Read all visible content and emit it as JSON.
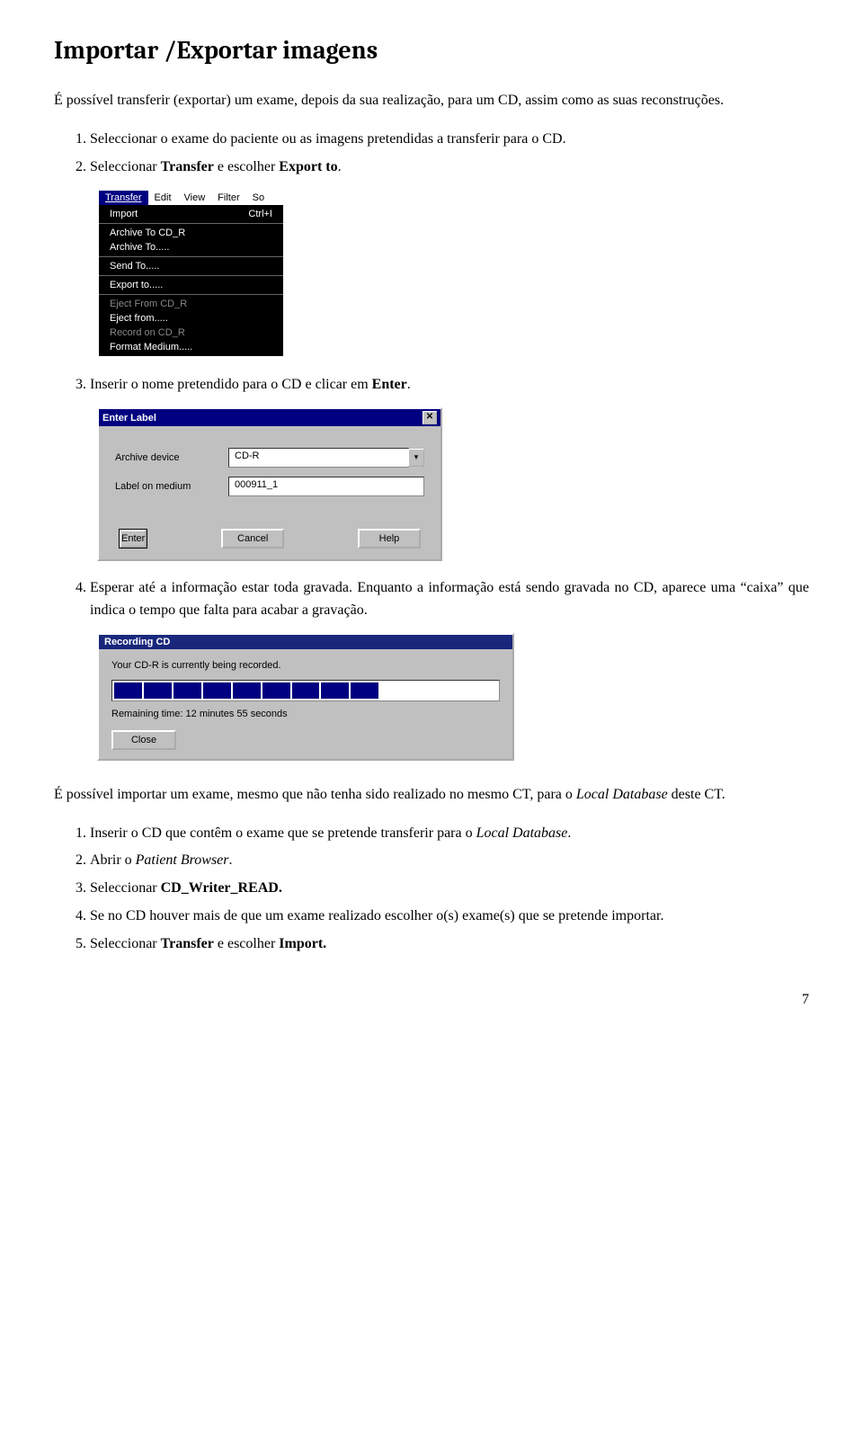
{
  "page": {
    "title": "Importar /Exportar imagens",
    "intro": "É possível transferir (exportar) um exame, depois da sua realização, para um CD, assim como as suas reconstruções.",
    "steps_a": {
      "1": "Seleccionar o exame do paciente ou as imagens pretendidas a transferir para o CD.",
      "2_pre": "Seleccionar ",
      "2_bold": "Transfer",
      "2_mid": " e escolher ",
      "2_bold2": "Export to",
      "2_post": ".",
      "3_pre": "Inserir o nome pretendido para o CD e clicar em ",
      "3_bold": "Enter",
      "3_post": ".",
      "4": "Esperar até a informação estar toda gravada. Enquanto a informação está sendo gravada no CD, aparece uma “caixa” que indica o tempo que falta para acabar a gravação."
    },
    "mid_para_pre": "É possível importar um exame, mesmo que não tenha sido realizado no mesmo CT, para o ",
    "mid_para_italic": "Local Database",
    "mid_para_post": " deste CT.",
    "steps_b": {
      "1_pre": "Inserir o CD que contêm o exame que se pretende transferir para o ",
      "1_italic": "Local Database",
      "1_post": ".",
      "2_pre": "Abrir o ",
      "2_italic": "Patient Browser",
      "2_post": ".",
      "3_pre": "Seleccionar ",
      "3_bold": "CD_Writer_READ.",
      "4": "Se no CD houver mais de que um exame realizado escolher o(s) exame(s) que se pretende importar.",
      "5_pre": "Seleccionar ",
      "5_bold": "Transfer",
      "5_mid": " e escolher ",
      "5_bold2": "Import."
    },
    "pagenum": "7"
  },
  "menu": {
    "tabs": [
      "Transfer",
      "Edit",
      "View",
      "Filter",
      "So"
    ],
    "items": {
      "import": "Import",
      "import_sc": "Ctrl+I",
      "archive_cdr": "Archive To CD_R",
      "archive_to": "Archive To.....",
      "send_to": "Send To.....",
      "export_to": "Export to.....",
      "eject_cdr": "Eject From CD_R",
      "eject_from": "Eject from.....",
      "record_cdr": "Record on CD_R",
      "format": "Format Medium....."
    }
  },
  "label_dlg": {
    "title": "Enter Label",
    "archive_lbl": "Archive device",
    "archive_val": "CD-R",
    "medium_lbl": "Label on medium",
    "medium_val": "000911_1",
    "enter": "Enter",
    "cancel": "Cancel",
    "help": "Help"
  },
  "recording": {
    "title": "Recording CD",
    "status": "Your CD-R is currently being recorded.",
    "filled": 9,
    "total": 13,
    "remaining": "Remaining time: 12 minutes 55 seconds",
    "close": "Close"
  }
}
